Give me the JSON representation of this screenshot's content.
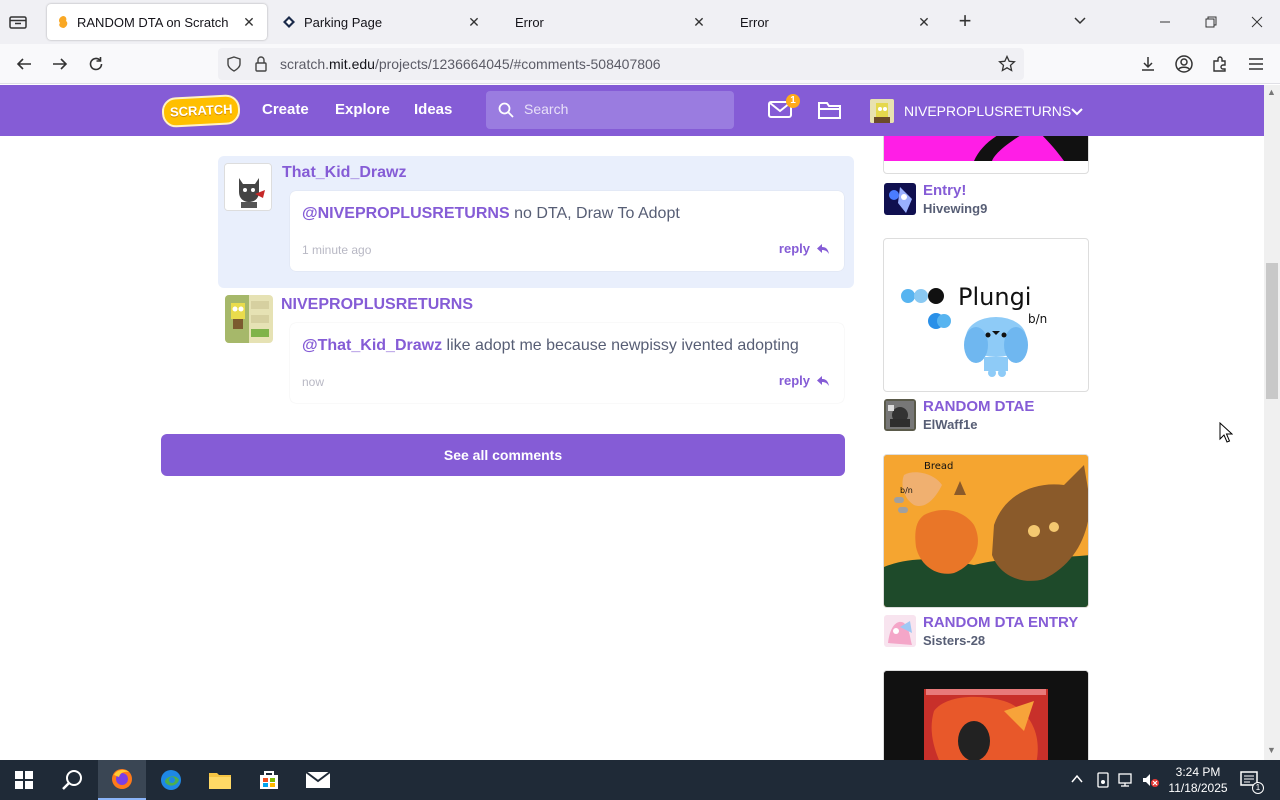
{
  "browser": {
    "tabs": [
      {
        "label": "RANDOM DTA on Scratch",
        "active": true
      },
      {
        "label": "Parking Page",
        "active": false
      },
      {
        "label": "Error",
        "active": false
      },
      {
        "label": "Error",
        "active": false
      }
    ],
    "url_prefix": "scratch.",
    "url_domain": "mit.edu",
    "url_path": "/projects/1236664045/#comments-508407806"
  },
  "scratch_nav": {
    "logo": "SCRATCH",
    "links": [
      "Create",
      "Explore",
      "Ideas"
    ],
    "search_placeholder": "Search",
    "message_count": "1",
    "username": "NIVEPROPLUSRETURNS"
  },
  "comments": [
    {
      "username": "That_Kid_Drawz",
      "mention": "@NIVEPROPLUSRETURNS",
      "text": " no DTA, Draw To Adopt",
      "time": "1 minute ago",
      "reply": "reply",
      "highlighted": true
    },
    {
      "username": "NIVEPROPLUSRETURNS",
      "mention": "@That_Kid_Drawz",
      "text": " like adopt me because newpissy ivented adopting",
      "time": "now",
      "reply": "reply",
      "highlighted": false
    }
  ],
  "see_all": "See all comments",
  "sidebar": [
    {
      "title": "Entry!",
      "author": "Hivewing9"
    },
    {
      "title": "RANDOM DTAE",
      "author": "ElWaff1e",
      "art_text": "Plungi",
      "art_subtext": "b/n"
    },
    {
      "title": "RANDOM DTA ENTRY",
      "author": "Sisters-28",
      "art_text": "Bread",
      "art_subtext": "b/n"
    }
  ],
  "taskbar": {
    "time": "3:24 PM",
    "date": "11/18/2025",
    "notif_count": "1"
  },
  "colors": {
    "scratch_purple": "#855cd6",
    "highlight": "#e9effc",
    "taskbar": "#1f2a37"
  }
}
